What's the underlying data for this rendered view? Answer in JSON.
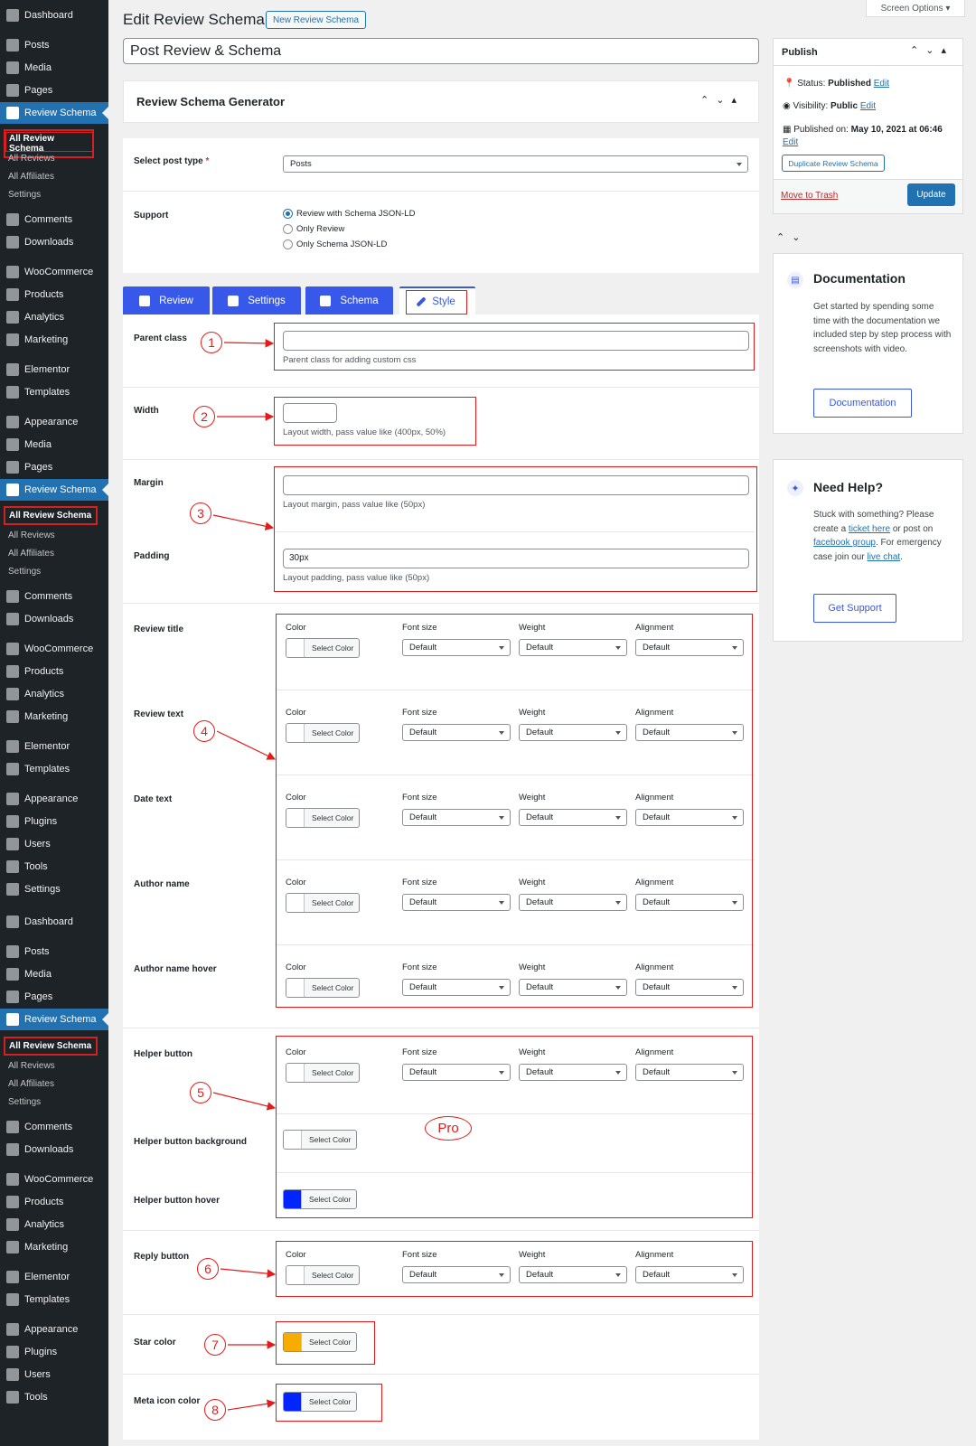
{
  "sidebar": {
    "items": [
      "Dashboard",
      "Posts",
      "Media",
      "Pages",
      "Review Schema",
      "Comments",
      "Downloads",
      "WooCommerce",
      "Products",
      "Analytics",
      "Marketing",
      "Elementor",
      "Templates",
      "Appearance",
      "Plugins",
      "Users",
      "Tools",
      "Settings"
    ],
    "submenu": [
      "All Review Schema",
      "All Reviews",
      "All Affiliates",
      "Settings"
    ]
  },
  "header": {
    "title": "Edit Review Schema",
    "new_button": "New Review Schema",
    "screen_options": "Screen Options"
  },
  "post_title": "Post Review & Schema",
  "metabox": {
    "title": "Review Schema Generator",
    "post_type_label": "Select post type",
    "post_type_value": "Posts",
    "support_label": "Support",
    "support_options": [
      "Review with Schema JSON-LD",
      "Only Review",
      "Only Schema JSON-LD"
    ],
    "support_selected": 0
  },
  "tabs": [
    "Review",
    "Settings",
    "Schema",
    "Style"
  ],
  "style": {
    "parent_class_label": "Parent class",
    "parent_class_value": "",
    "parent_class_help": "Parent class for adding custom css",
    "width_label": "Width",
    "width_value": "",
    "width_help": "Layout width, pass value like (400px, 50%)",
    "margin_label": "Margin",
    "margin_value": "",
    "margin_help": "Layout margin, pass value like (50px)",
    "padding_label": "Padding",
    "padding_value": "30px",
    "padding_help": "Layout padding, pass value like (50px)",
    "group_headers": [
      "Color",
      "Font size",
      "Weight",
      "Alignment"
    ],
    "select_color": "Select Color",
    "default": "Default",
    "rows": [
      "Review title",
      "Review text",
      "Date text",
      "Author name",
      "Author name hover",
      "Helper button",
      "Helper button background",
      "Helper button hover",
      "Reply button",
      "Star color",
      "Meta icon color"
    ],
    "colors": {
      "helper_hover": "#0025ff",
      "star": "#f7ad00",
      "meta_icon": "#0025ff"
    }
  },
  "annotations": [
    "1",
    "2",
    "3",
    "4",
    "5",
    "6",
    "7",
    "8"
  ],
  "pro_label": "Pro",
  "publish": {
    "title": "Publish",
    "status_label": "Status:",
    "status_value": "Published",
    "visibility_label": "Visibility:",
    "visibility_value": "Public",
    "published_on": "Published on:",
    "published_date": "May 10, 2021 at 06:46",
    "edit": "Edit",
    "duplicate": "Duplicate Review Schema",
    "trash": "Move to Trash",
    "update": "Update"
  },
  "documentation": {
    "title": "Documentation",
    "text": "Get started by spending some time with the documentation we included step by step process with screenshots with video.",
    "button": "Documentation"
  },
  "help": {
    "title": "Need Help?",
    "text1": "Stuck with something? Please create a",
    "link1": "ticket here",
    "text2": "or post on",
    "link2": "facebook group",
    "text3": ". For emergency case join our",
    "link3": "live chat",
    "button": "Get Support"
  }
}
